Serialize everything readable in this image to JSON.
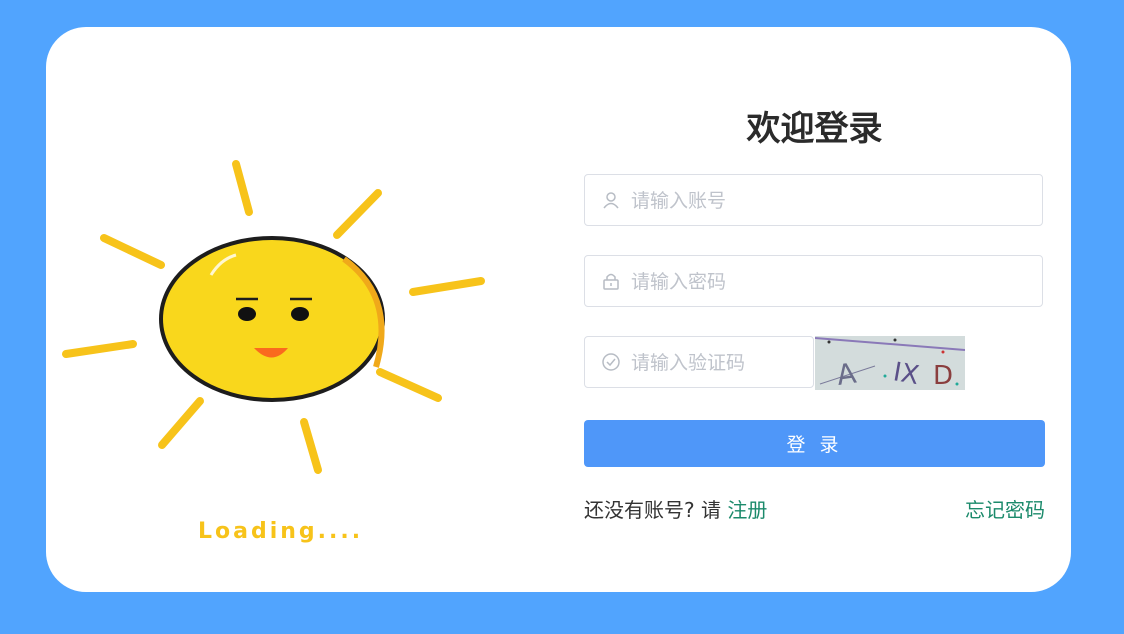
{
  "colors": {
    "background": "#51a4fe",
    "card": "#ffffff",
    "button": "#4f97f9",
    "link": "#1b8a6b",
    "sun": "#f9d71c"
  },
  "illustration": {
    "loading_text": "Loading...."
  },
  "form": {
    "title": "欢迎登录",
    "username": {
      "placeholder": "请输入账号",
      "icon": "user-icon"
    },
    "password": {
      "placeholder": "请输入密码",
      "icon": "lock-icon"
    },
    "captcha": {
      "placeholder": "请输入验证码",
      "icon": "check-circle-icon",
      "code": "A IX D"
    },
    "login_label": "登 录",
    "register_prompt": "还没有账号? 请",
    "register_link": "注册",
    "forgot_link": "忘记密码"
  }
}
